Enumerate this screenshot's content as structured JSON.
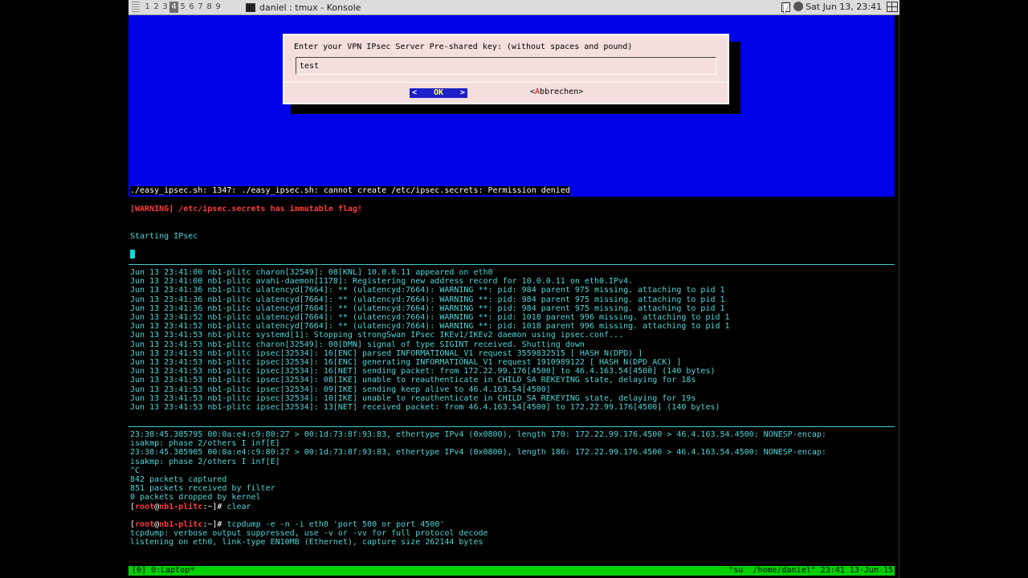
{
  "panel": {
    "pager": [
      "1",
      "2",
      "3",
      "4",
      "5",
      "6",
      "7",
      "8",
      "9"
    ],
    "active_desktop": "4",
    "task_title": "daniel : tmux - Konsole",
    "clock": "Sat Jun 13, 23:41"
  },
  "dialog": {
    "prompt": "Enter your VPN IPsec Server Pre-shared key: (without spaces and pound)",
    "input_value": "test",
    "ok_left": "<",
    "ok_label": "OK",
    "ok_right": ">",
    "cancel_open": "<",
    "cancel_hot": "A",
    "cancel_rest": "bbrechen>"
  },
  "pane1": {
    "error_line": "./easy_ipsec.sh: 1347: ./easy_ipsec.sh: cannot create /etc/ipsec.secrets: Permission denied",
    "warning_tag": "[WARNING]",
    "warning_text": " /etc/ipsec.secrets has immutable flag!",
    "starting": "Starting IPsec"
  },
  "log_lines": [
    "Jun 13 23:41:00 nb1-plitc charon[32549]: 08[KNL] 10.0.0.11 appeared on eth0",
    "Jun 13 23:41:00 nb1-plitc avahi-daemon[1178]: Registering new address record for 10.0.0.11 on eth0.IPv4.",
    "Jun 13 23:41:36 nb1-plitc ulatencyd[7664]: ** (ulatencyd:7664): WARNING **: pid: 984 parent 975 missing. attaching to pid 1",
    "Jun 13 23:41:36 nb1-plitc ulatencyd[7664]: ** (ulatencyd:7664): WARNING **: pid: 984 parent 975 missing. attaching to pid 1",
    "Jun 13 23:41:36 nb1-plitc ulatencyd[7664]: ** (ulatencyd:7664): WARNING **: pid: 984 parent 975 missing. attaching to pid 1",
    "Jun 13 23:41:52 nb1-plitc ulatencyd[7664]: ** (ulatencyd:7664): WARNING **: pid: 1018 parent 996 missing. attaching to pid 1",
    "Jun 13 23:41:52 nb1-plitc ulatencyd[7664]: ** (ulatencyd:7664): WARNING **: pid: 1018 parent 996 missing. attaching to pid 1",
    "Jun 13 23:41:53 nb1-plitc systemd[1]: Stopping strongSwan IPsec IKEv1/IKEv2 daemon using ipsec.conf...",
    "Jun 13 23:41:53 nb1-plitc charon[32549]: 00[DMN] signal of type SIGINT received. Shutting down",
    "Jun 13 23:41:53 nb1-plitc ipsec[32534]: 16[ENC] parsed INFORMATIONAL_V1 request 3559832515 [ HASH N(DPD) ]",
    "Jun 13 23:41:53 nb1-plitc ipsec[32534]: 16[ENC] generating INFORMATIONAL_V1 request 1910989122 [ HASH N(DPD_ACK) ]",
    "Jun 13 23:41:53 nb1-plitc ipsec[32534]: 16[NET] sending packet: from 172.22.99.176[4500] to 46.4.163.54[4500] (140 bytes)",
    "Jun 13 23:41:53 nb1-plitc ipsec[32534]: 08[IKE] unable to reauthenticate in CHILD_SA REKEYING state, delaying for 18s",
    "Jun 13 23:41:53 nb1-plitc ipsec[32534]: 09[IKE] sending keep alive to 46.4.163.54[4500]",
    "Jun 13 23:41:53 nb1-plitc ipsec[32534]: 10[IKE] unable to reauthenticate in CHILD_SA REKEYING state, delaying for 19s",
    "Jun 13 23:41:53 nb1-plitc ipsec[32534]: 13[NET] received packet: from 46.4.163.54[4500] to 172.22.99.176[4500] (140 bytes)"
  ],
  "tcp_lines": [
    "23:38:45.385795 00:0a:e4:c9:80:27 > 00:1d:73:8f:93:83, ethertype IPv4 (0x0800), length 170: 172.22.99.176.4500 > 46.4.163.54.4500: NONESP-encap:",
    "isakmp: phase 2/others I inf[E]",
    "23:38:45.385905 00:0a:e4:c9:80:27 > 00:1d:73:8f:93:83, ethertype IPv4 (0x0800), length 186: 172.22.99.176.4500 > 46.4.163.54.4500: NONESP-encap:",
    "isakmp: phase 2/others I inf[E]",
    "^C",
    "842 packets captured",
    "851 packets received by filter",
    "0 packets dropped by kernel"
  ],
  "prompt1": {
    "user": "root",
    "at": "@",
    "host": "nb1-plitc",
    "path": ":~]# ",
    "cmd": "clear"
  },
  "prompt2": {
    "user": "root",
    "at": "@",
    "host": "nb1-plitc",
    "path": ":~]# ",
    "cmd": "tcpdump -e -n -i eth0 'port 500 or port 4500'"
  },
  "tcp_after": [
    "tcpdump: verbose output suppressed, use -v or -vv for full protocol decode",
    "listening on eth0, link-type EN10MB (Ethernet), capture size 262144 bytes"
  ],
  "status": {
    "left": "[0] 0:Laptop*",
    "right": "\"su  /home/daniel\" 23:41 13-Jun-15"
  },
  "colors": {
    "dialog_bg": "#0000e8",
    "text_cyan": "#4fd6d6",
    "warning_red": "#ff3b3b",
    "status_green": "#00d000"
  }
}
